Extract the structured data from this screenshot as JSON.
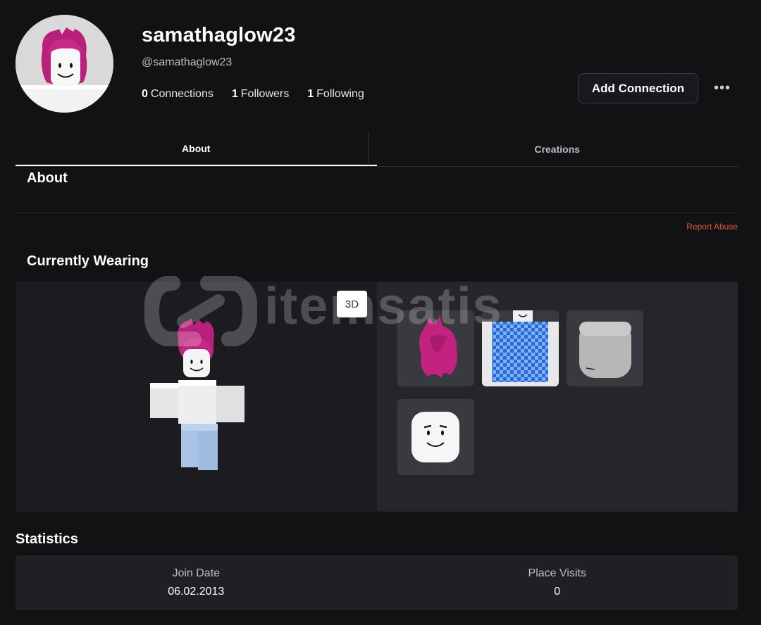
{
  "profile": {
    "display_name": "samathaglow23",
    "username": "@samathaglow23",
    "connections_count": "0",
    "connections_label": "Connections",
    "followers_count": "1",
    "followers_label": "Followers",
    "following_count": "1",
    "following_label": "Following",
    "add_connection_label": "Add Connection",
    "more_label": "•••"
  },
  "tabs": [
    {
      "label": "About",
      "active": true
    },
    {
      "label": "Creations",
      "active": false
    }
  ],
  "about": {
    "title": "About",
    "report_label": "Report Abuse"
  },
  "wearing": {
    "title": "Currently Wearing",
    "view_toggle_label": "3D",
    "items": [
      {
        "name": "pink-hair-icon"
      },
      {
        "name": "blue-checkered-shirt-icon"
      },
      {
        "name": "gray-head-icon"
      },
      {
        "name": "smile-face-icon"
      }
    ]
  },
  "watermark": {
    "text": "itemsatis"
  },
  "statistics": {
    "title": "Statistics",
    "join_date_label": "Join Date",
    "join_date_value": "06.02.2013",
    "place_visits_label": "Place Visits",
    "place_visits_value": "0"
  },
  "colors": {
    "background": "#121215",
    "panel": "#1f2024",
    "report_link": "#e0563a",
    "hair": "#c2267e"
  }
}
